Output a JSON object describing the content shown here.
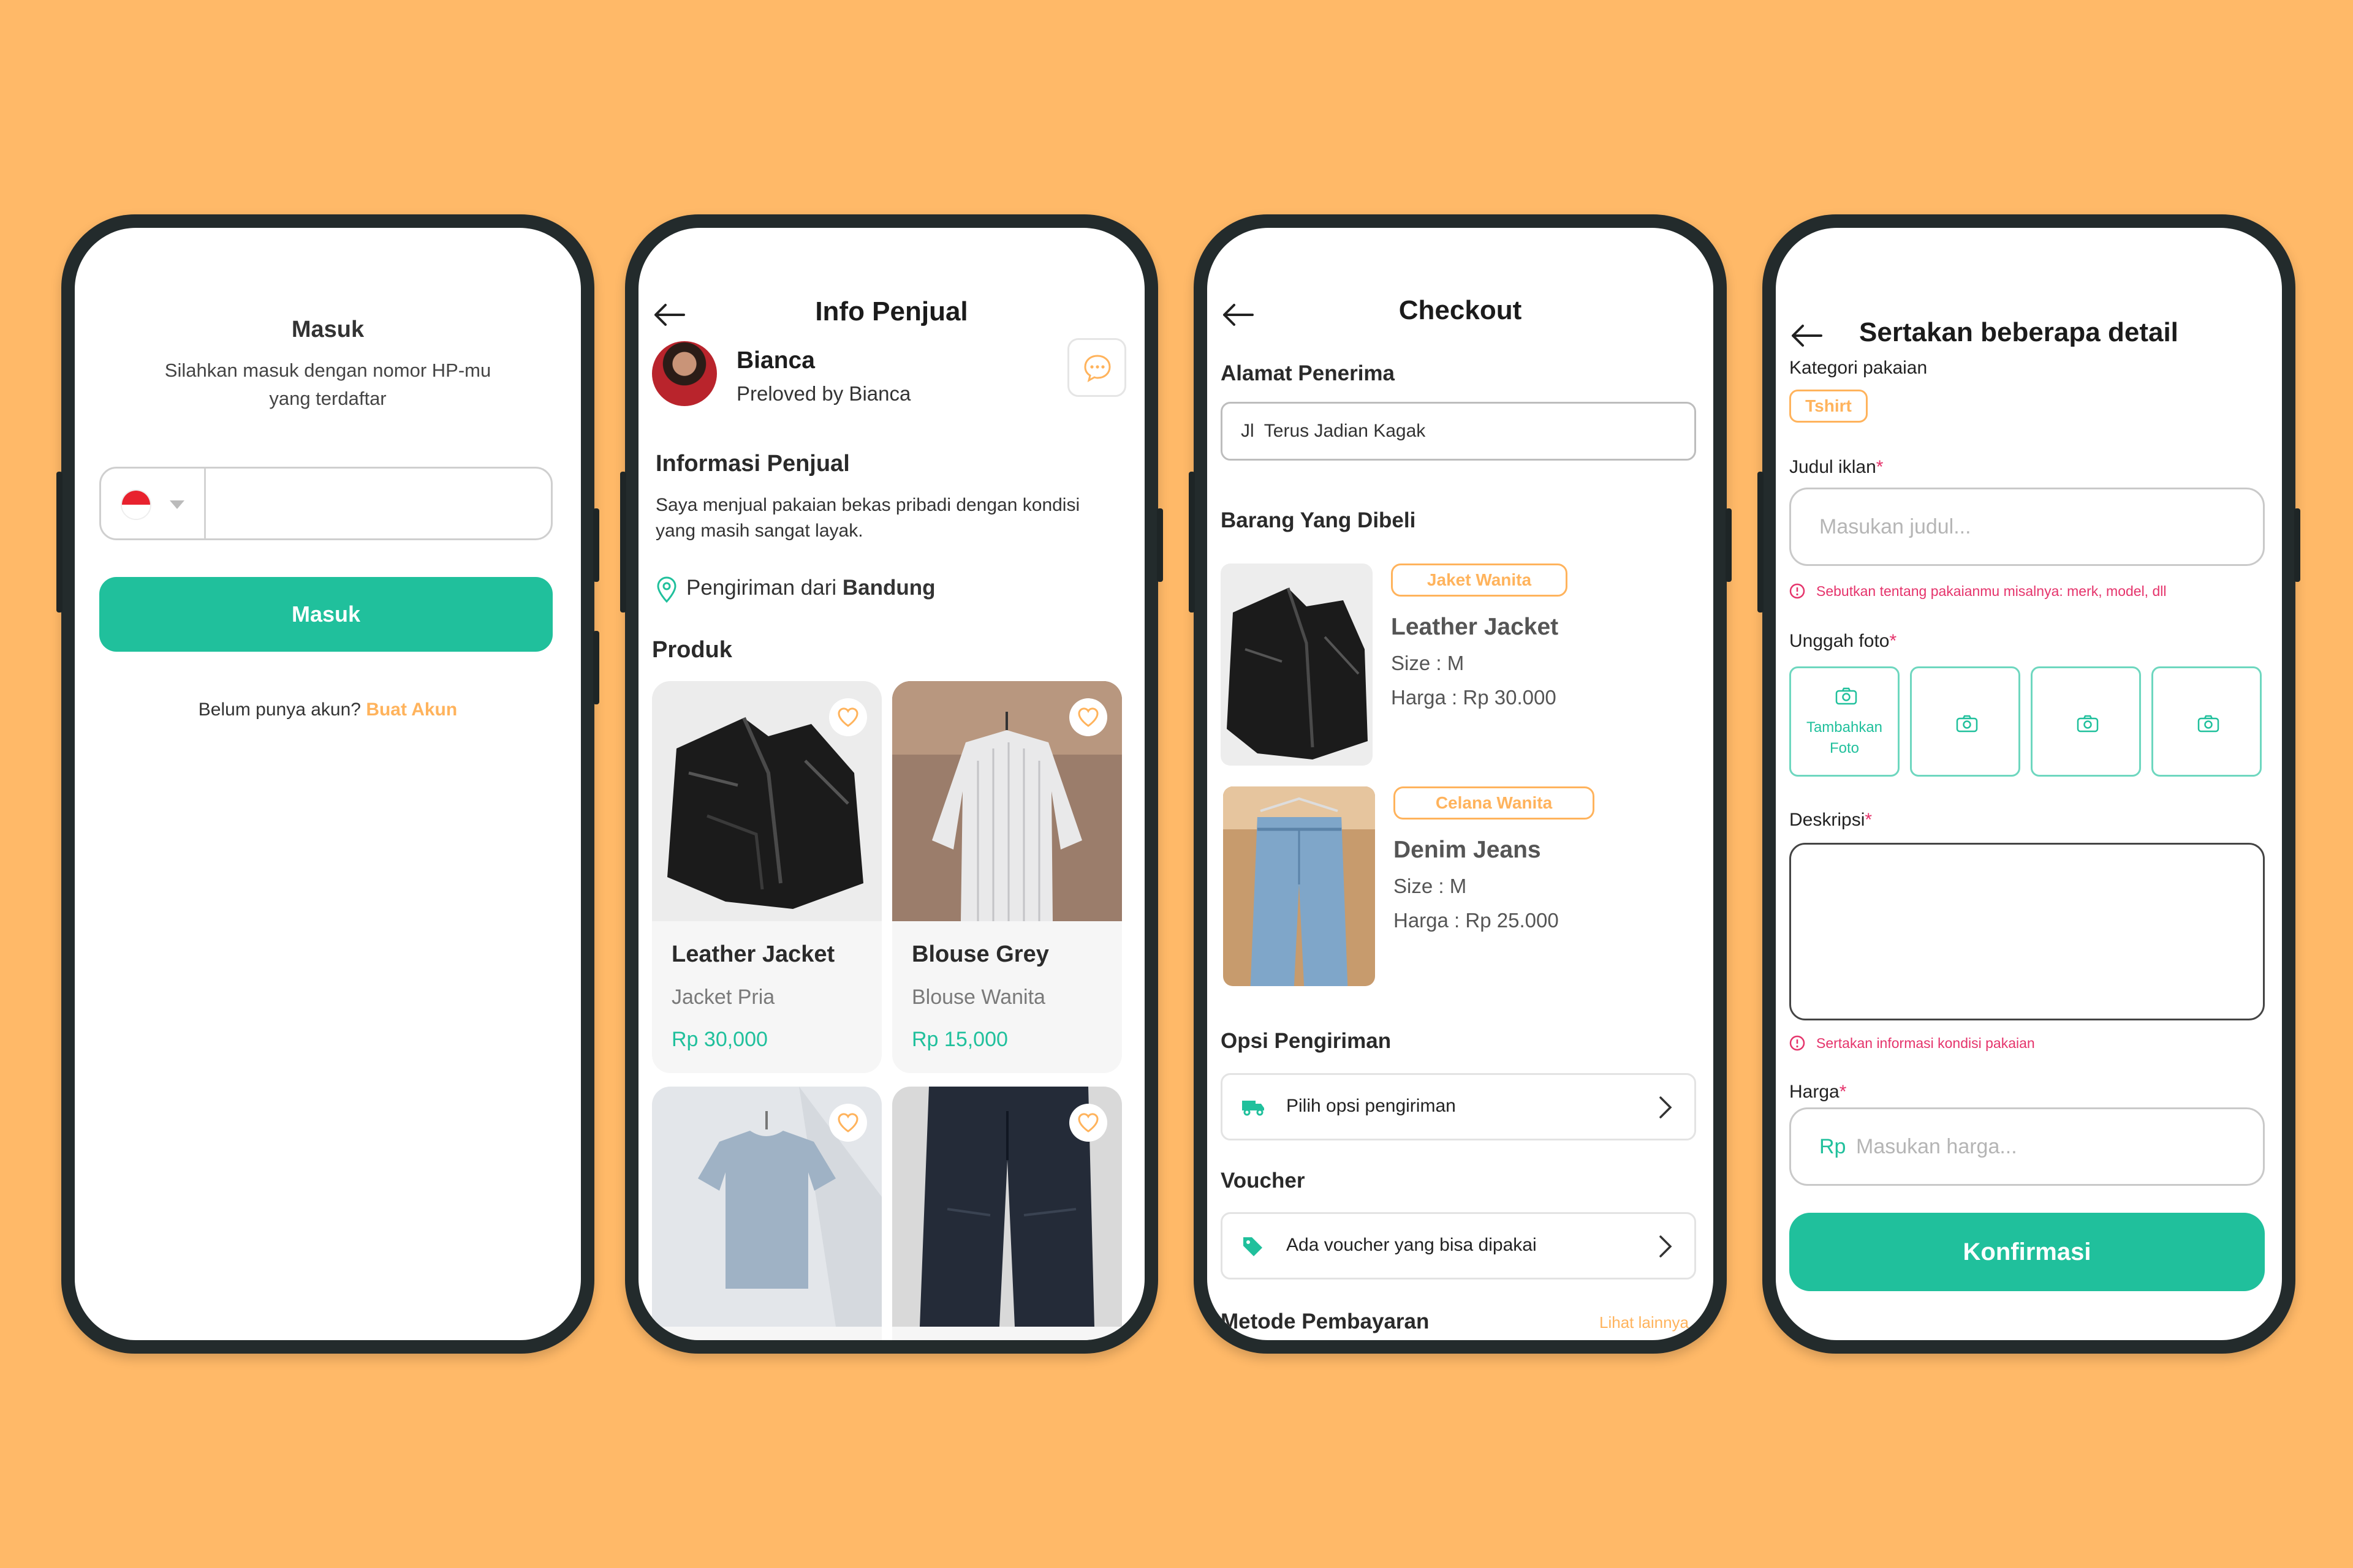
{
  "colors": {
    "background": "#FFB968",
    "accent": "#20C09C",
    "highlight": "#FFB35C",
    "error": "#E5336B",
    "frame": "#232b2c"
  },
  "login": {
    "title": "Masuk",
    "subtitle_line1": "Silahkan masuk dengan nomor HP-mu",
    "subtitle_line2": "yang terdaftar",
    "phone_placeholder": "",
    "country_flag": "indonesia-flag-icon",
    "button": "Masuk",
    "no_account": "Belum punya akun?",
    "create_account": "Buat Akun"
  },
  "seller": {
    "title": "Info Penjual",
    "name": "Bianca",
    "store": "Preloved by Bianca",
    "info_title": "Informasi Penjual",
    "info_text_line1": "Saya menjual pakaian bekas pribadi dengan kondisi",
    "info_text_line2": "yang masih sangat layak.",
    "shipping_prefix": "Pengiriman dari",
    "shipping_city": "Bandung",
    "products_title": "Produk",
    "products": [
      {
        "name": "Leather Jacket",
        "category": "Jacket Pria",
        "price": "Rp 30,000"
      },
      {
        "name": "Blouse Grey",
        "category": "Blouse Wanita",
        "price": "Rp 15,000"
      },
      {
        "name": "",
        "category": "",
        "price": ""
      },
      {
        "name": "",
        "category": "",
        "price": ""
      }
    ]
  },
  "checkout": {
    "title": "Checkout",
    "address_label": "Alamat Penerima",
    "address_value": "Jl  Terus Jadian Kagak",
    "items_label": "Barang Yang Dibeli",
    "items": [
      {
        "tag": "Jaket Wanita",
        "name": "Leather Jacket",
        "size": "Size : M",
        "price": "Harga : Rp 30.000"
      },
      {
        "tag": "Celana Wanita",
        "name": "Denim Jeans",
        "size": "Size : M",
        "price": "Harga : Rp 25.000"
      }
    ],
    "shipping_label": "Opsi Pengiriman",
    "shipping_option": "Pilih opsi pengiriman",
    "voucher_label": "Voucher",
    "voucher_option": "Ada voucher yang bisa dipakai",
    "payment_label": "Metode Pembayaran",
    "payment_link": "Lihat lainnya"
  },
  "detail": {
    "title": "Sertakan beberapa detail",
    "category_label": "Kategori pakaian",
    "category_tag": "Tshirt",
    "judul_label": "Judul iklan",
    "required_mark": "*",
    "judul_placeholder": "Masukan judul...",
    "judul_hint": "Sebutkan tentang pakaianmu misalnya: merk, model, dll",
    "foto_label": "Unggah foto",
    "add_photo_line1": "Tambahkan",
    "add_photo_line2": "Foto",
    "desc_label": "Deskripsi",
    "desc_hint": "Sertakan informasi kondisi pakaian",
    "price_label": "Harga",
    "price_prefix": "Rp",
    "price_placeholder": "Masukan harga...",
    "button": "Konfirmasi"
  }
}
